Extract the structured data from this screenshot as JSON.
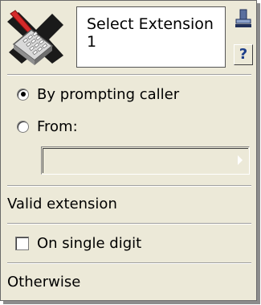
{
  "node": {
    "icon": "select-extension-node-icon",
    "title_line1": "Select Extension",
    "title_line2": "1",
    "stamp_icon": "stamp-icon",
    "help_label": "?"
  },
  "source": {
    "options": [
      {
        "label": "By prompting caller",
        "checked": true
      },
      {
        "label": "From:",
        "checked": false
      }
    ],
    "from_value": "",
    "dropdown_icon": "triangle-right-icon"
  },
  "branches": {
    "valid_label": "Valid extension",
    "single_digit_label": "On single digit",
    "single_digit_checked": false,
    "otherwise_label": "Otherwise"
  }
}
